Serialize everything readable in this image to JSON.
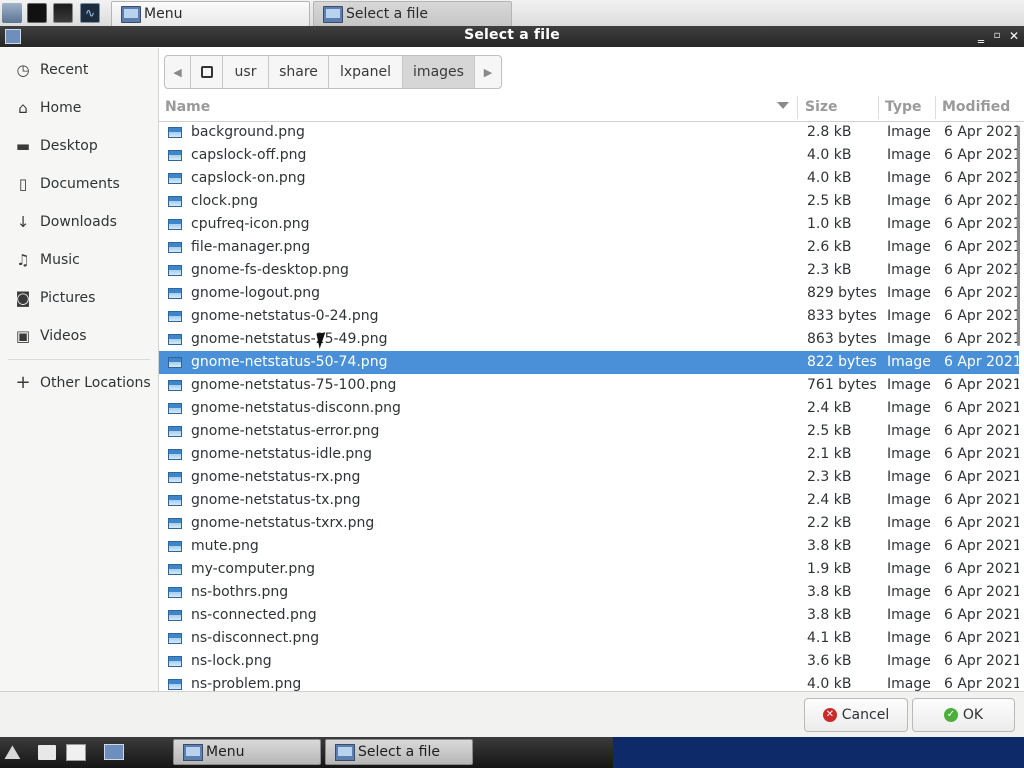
{
  "top_taskbar": {
    "icons": [
      "computer-icon",
      "terminal-icon",
      "monitor-icon",
      "system-monitor-icon"
    ],
    "tasks": [
      {
        "label": "Menu",
        "icon": "computer-icon",
        "active": false
      },
      {
        "label": "Select a file",
        "icon": "computer-icon",
        "active": true
      }
    ]
  },
  "window": {
    "title": "Select a file",
    "controls": [
      "minimize-icon",
      "maximize-icon",
      "close-icon"
    ]
  },
  "sidebar": {
    "items": [
      {
        "label": "Recent",
        "icon": "clock-icon"
      },
      {
        "label": "Home",
        "icon": "home-icon"
      },
      {
        "label": "Desktop",
        "icon": "folder-icon"
      },
      {
        "label": "Documents",
        "icon": "document-icon"
      },
      {
        "label": "Downloads",
        "icon": "download-icon"
      },
      {
        "label": "Music",
        "icon": "music-icon"
      },
      {
        "label": "Pictures",
        "icon": "camera-icon"
      },
      {
        "label": "Videos",
        "icon": "video-icon"
      }
    ],
    "other": {
      "label": "Other Locations",
      "icon": "plus-icon"
    }
  },
  "pathbar": {
    "segments": [
      "usr",
      "share",
      "lxpanel",
      "images"
    ],
    "current": "images"
  },
  "columns": {
    "name": "Name",
    "size": "Size",
    "type": "Type",
    "modified": "Modified"
  },
  "files": [
    {
      "name": "background.png",
      "size": "2.8 kB",
      "type": "Image",
      "modified": "6 Apr 2021"
    },
    {
      "name": "capslock-off.png",
      "size": "4.0 kB",
      "type": "Image",
      "modified": "6 Apr 2021"
    },
    {
      "name": "capslock-on.png",
      "size": "4.0 kB",
      "type": "Image",
      "modified": "6 Apr 2021"
    },
    {
      "name": "clock.png",
      "size": "2.5 kB",
      "type": "Image",
      "modified": "6 Apr 2021"
    },
    {
      "name": "cpufreq-icon.png",
      "size": "1.0 kB",
      "type": "Image",
      "modified": "6 Apr 2021"
    },
    {
      "name": "file-manager.png",
      "size": "2.6 kB",
      "type": "Image",
      "modified": "6 Apr 2021"
    },
    {
      "name": "gnome-fs-desktop.png",
      "size": "2.3 kB",
      "type": "Image",
      "modified": "6 Apr 2021"
    },
    {
      "name": "gnome-logout.png",
      "size": "829 bytes",
      "type": "Image",
      "modified": "6 Apr 2021"
    },
    {
      "name": "gnome-netstatus-0-24.png",
      "size": "833 bytes",
      "type": "Image",
      "modified": "6 Apr 2021"
    },
    {
      "name": "gnome-netstatus-25-49.png",
      "size": "863 bytes",
      "type": "Image",
      "modified": "6 Apr 2021"
    },
    {
      "name": "gnome-netstatus-50-74.png",
      "size": "822 bytes",
      "type": "Image",
      "modified": "6 Apr 2021",
      "selected": true
    },
    {
      "name": "gnome-netstatus-75-100.png",
      "size": "761 bytes",
      "type": "Image",
      "modified": "6 Apr 2021"
    },
    {
      "name": "gnome-netstatus-disconn.png",
      "size": "2.4 kB",
      "type": "Image",
      "modified": "6 Apr 2021"
    },
    {
      "name": "gnome-netstatus-error.png",
      "size": "2.5 kB",
      "type": "Image",
      "modified": "6 Apr 2021"
    },
    {
      "name": "gnome-netstatus-idle.png",
      "size": "2.1 kB",
      "type": "Image",
      "modified": "6 Apr 2021"
    },
    {
      "name": "gnome-netstatus-rx.png",
      "size": "2.3 kB",
      "type": "Image",
      "modified": "6 Apr 2021"
    },
    {
      "name": "gnome-netstatus-tx.png",
      "size": "2.4 kB",
      "type": "Image",
      "modified": "6 Apr 2021"
    },
    {
      "name": "gnome-netstatus-txrx.png",
      "size": "2.2 kB",
      "type": "Image",
      "modified": "6 Apr 2021"
    },
    {
      "name": "mute.png",
      "size": "3.8 kB",
      "type": "Image",
      "modified": "6 Apr 2021"
    },
    {
      "name": "my-computer.png",
      "size": "1.9 kB",
      "type": "Image",
      "modified": "6 Apr 2021"
    },
    {
      "name": "ns-bothrs.png",
      "size": "3.8 kB",
      "type": "Image",
      "modified": "6 Apr 2021"
    },
    {
      "name": "ns-connected.png",
      "size": "3.8 kB",
      "type": "Image",
      "modified": "6 Apr 2021"
    },
    {
      "name": "ns-disconnect.png",
      "size": "4.1 kB",
      "type": "Image",
      "modified": "6 Apr 2021"
    },
    {
      "name": "ns-lock.png",
      "size": "3.6 kB",
      "type": "Image",
      "modified": "6 Apr 2021"
    },
    {
      "name": "ns-problem.png",
      "size": "4.0 kB",
      "type": "Image",
      "modified": "6 Apr 2021"
    }
  ],
  "buttons": {
    "cancel": "Cancel",
    "ok": "OK"
  },
  "bottom_panel": {
    "tasks": [
      {
        "label": "Menu",
        "icon": "computer-icon"
      },
      {
        "label": "Select a file",
        "icon": "computer-icon"
      }
    ]
  },
  "colors": {
    "selection": "#4a90d9",
    "titlebar": "#2d2d2d",
    "panel": "#0f2a68"
  }
}
